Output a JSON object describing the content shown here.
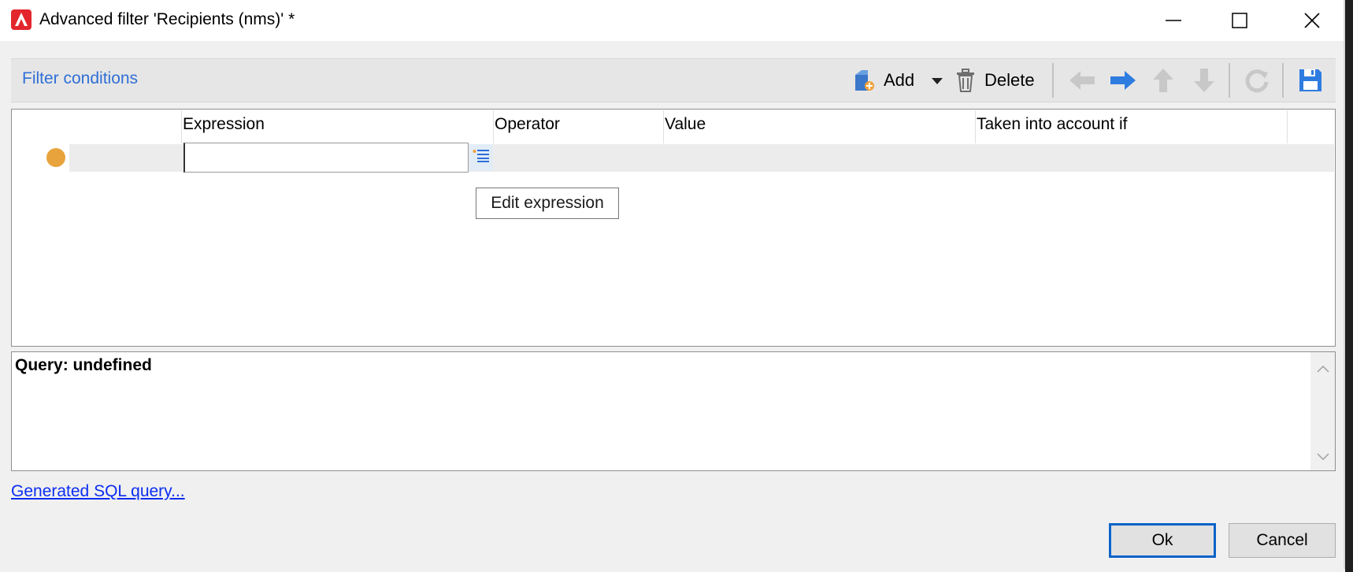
{
  "window": {
    "title": "Advanced filter 'Recipients (nms)' *",
    "icon": "adobe-campaign-icon",
    "controls": [
      "minimize-icon",
      "maximize-icon",
      "close-icon"
    ]
  },
  "toolbar": {
    "section_title": "Filter conditions",
    "add_label": "Add",
    "delete_label": "Delete",
    "icons": [
      "add-icon",
      "dropdown-arrow-icon",
      "trash-icon",
      "arrow-left-icon",
      "arrow-right-icon",
      "arrow-up-icon",
      "arrow-down-icon",
      "refresh-icon",
      "save-icon"
    ]
  },
  "grid": {
    "columns": [
      "Expression",
      "Operator",
      "Value",
      "Taken into account if"
    ],
    "rows": [
      {
        "status_color": "#e8a33d",
        "expression": "",
        "operator": "",
        "value": "",
        "condition": ""
      }
    ],
    "tooltip": "Edit expression"
  },
  "query": {
    "text": "Query: undefined"
  },
  "links": {
    "generated_sql": "Generated SQL query..."
  },
  "buttons": {
    "ok": "Ok",
    "cancel": "Cancel"
  },
  "colors": {
    "accent": "#2f6fd6",
    "link": "#0a2cf0",
    "status_dot": "#e8a33d",
    "app_icon": "#e3262d",
    "default_button_border": "#0a63c9"
  }
}
